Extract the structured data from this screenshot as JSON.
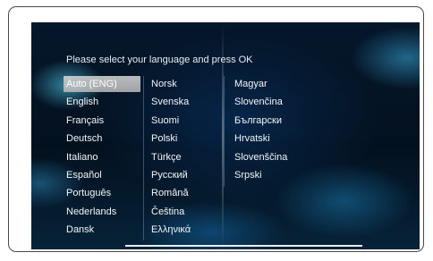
{
  "prompt": "Please select your language and press OK",
  "selected_language": "Auto (ENG)",
  "columns": [
    [
      "Auto (ENG)",
      "English",
      "Français",
      "Deutsch",
      "Italiano",
      "Español",
      "Português",
      "Nederlands",
      "Dansk"
    ],
    [
      "Norsk",
      "Svenska",
      "Suomi",
      "Polski",
      "Türkçe",
      "Русский",
      "Română",
      "Čeština",
      "Ελληνικά"
    ],
    [
      "Magyar",
      "Slovenčina",
      "Български",
      "Hrvatski",
      "Slovenščina",
      "Srpski"
    ]
  ]
}
